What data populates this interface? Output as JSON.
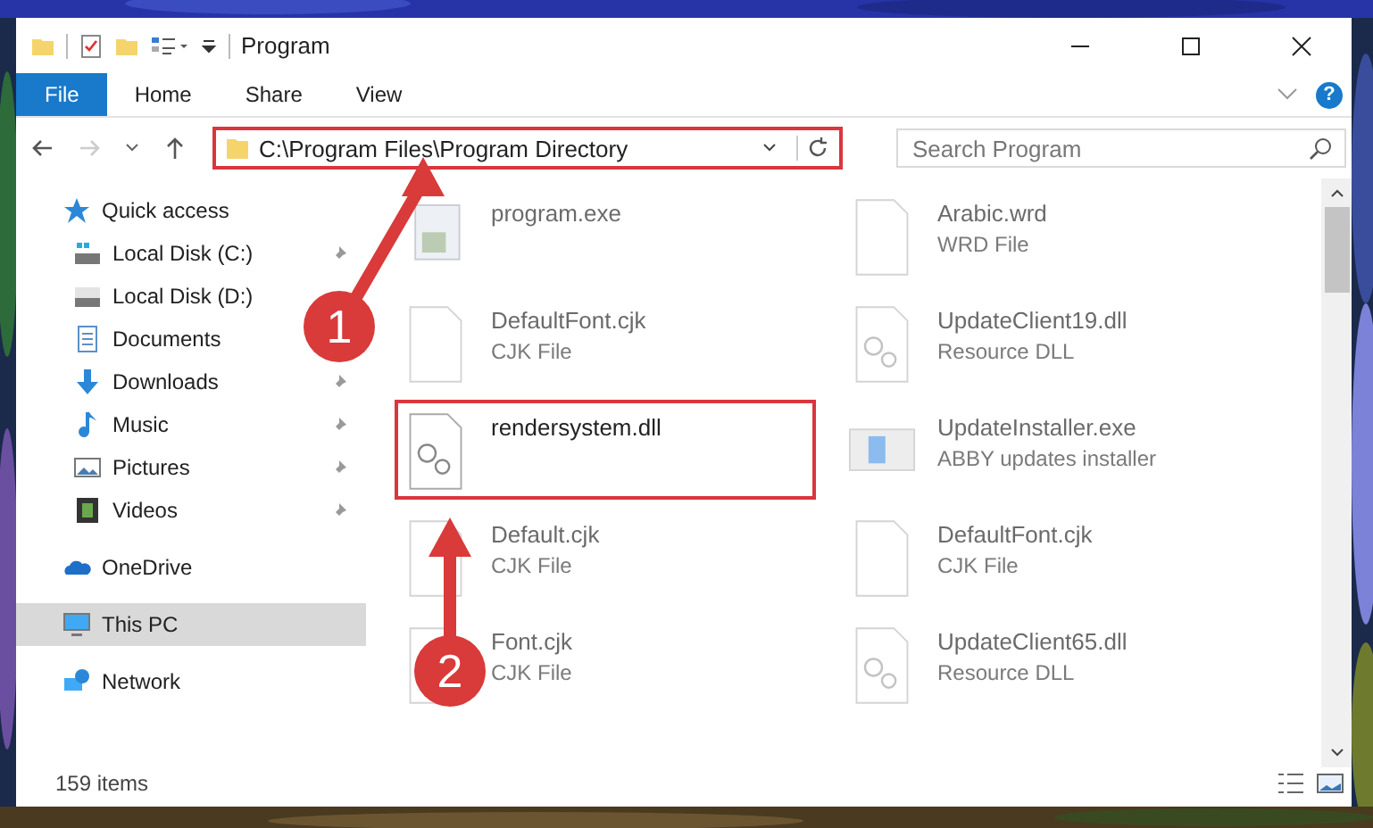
{
  "window": {
    "title": "Program"
  },
  "ribbon": {
    "tabs": [
      {
        "label": "File",
        "selected": true
      },
      {
        "label": "Home",
        "selected": false
      },
      {
        "label": "Share",
        "selected": false
      },
      {
        "label": "View",
        "selected": false
      }
    ],
    "help": "?"
  },
  "address": {
    "path": "C:\\Program Files\\Program Directory"
  },
  "search": {
    "placeholder": "Search Program"
  },
  "sidebar": {
    "items": [
      {
        "label": "Quick access",
        "selected": false,
        "children": [
          {
            "label": "Local Disk (C:)",
            "pinned": true,
            "selected": false
          },
          {
            "label": "Local Disk (D:)",
            "pinned": false,
            "selected": false
          },
          {
            "label": "Documents",
            "pinned": false,
            "selected": false
          },
          {
            "label": "Downloads",
            "pinned": true,
            "selected": false
          },
          {
            "label": "Music",
            "pinned": true,
            "selected": false
          },
          {
            "label": "Pictures",
            "pinned": true,
            "selected": false
          },
          {
            "label": "Videos",
            "pinned": true,
            "selected": false
          }
        ]
      },
      {
        "label": "OneDrive",
        "selected": false
      },
      {
        "label": "This PC",
        "selected": true
      },
      {
        "label": "Network",
        "selected": false
      }
    ]
  },
  "files": [
    {
      "name": "program.exe",
      "kind": "exe",
      "highlighted": false
    },
    {
      "name": "Arabic.wrd",
      "type": "WRD File",
      "kind": "blank",
      "highlighted": false
    },
    {
      "name": "DefaultFont.cjk",
      "type": "CJK File",
      "kind": "blank",
      "highlighted": false
    },
    {
      "name": "UpdateClient19.dll",
      "type": "Resource DLL",
      "kind": "dll",
      "highlighted": false
    },
    {
      "name": "rendersystem.dll",
      "kind": "dll",
      "highlighted": true
    },
    {
      "name": "UpdateInstaller.exe",
      "type": "ABBY updates installer",
      "kind": "installer",
      "highlighted": false
    },
    {
      "name": "Default.cjk",
      "type": "CJK File",
      "kind": "blank",
      "highlighted": false
    },
    {
      "name": "DefaultFont.cjk",
      "type": "CJK File",
      "kind": "blank",
      "highlighted": false
    },
    {
      "name": "Font.cjk",
      "type": "CJK File",
      "kind": "blank",
      "highlighted": false
    },
    {
      "name": "UpdateClient65.dll",
      "type": "Resource DLL",
      "kind": "dll",
      "highlighted": false
    }
  ],
  "status_bar": {
    "count": "159 items"
  },
  "callouts": [
    {
      "number": "1"
    },
    {
      "number": "2"
    }
  ]
}
